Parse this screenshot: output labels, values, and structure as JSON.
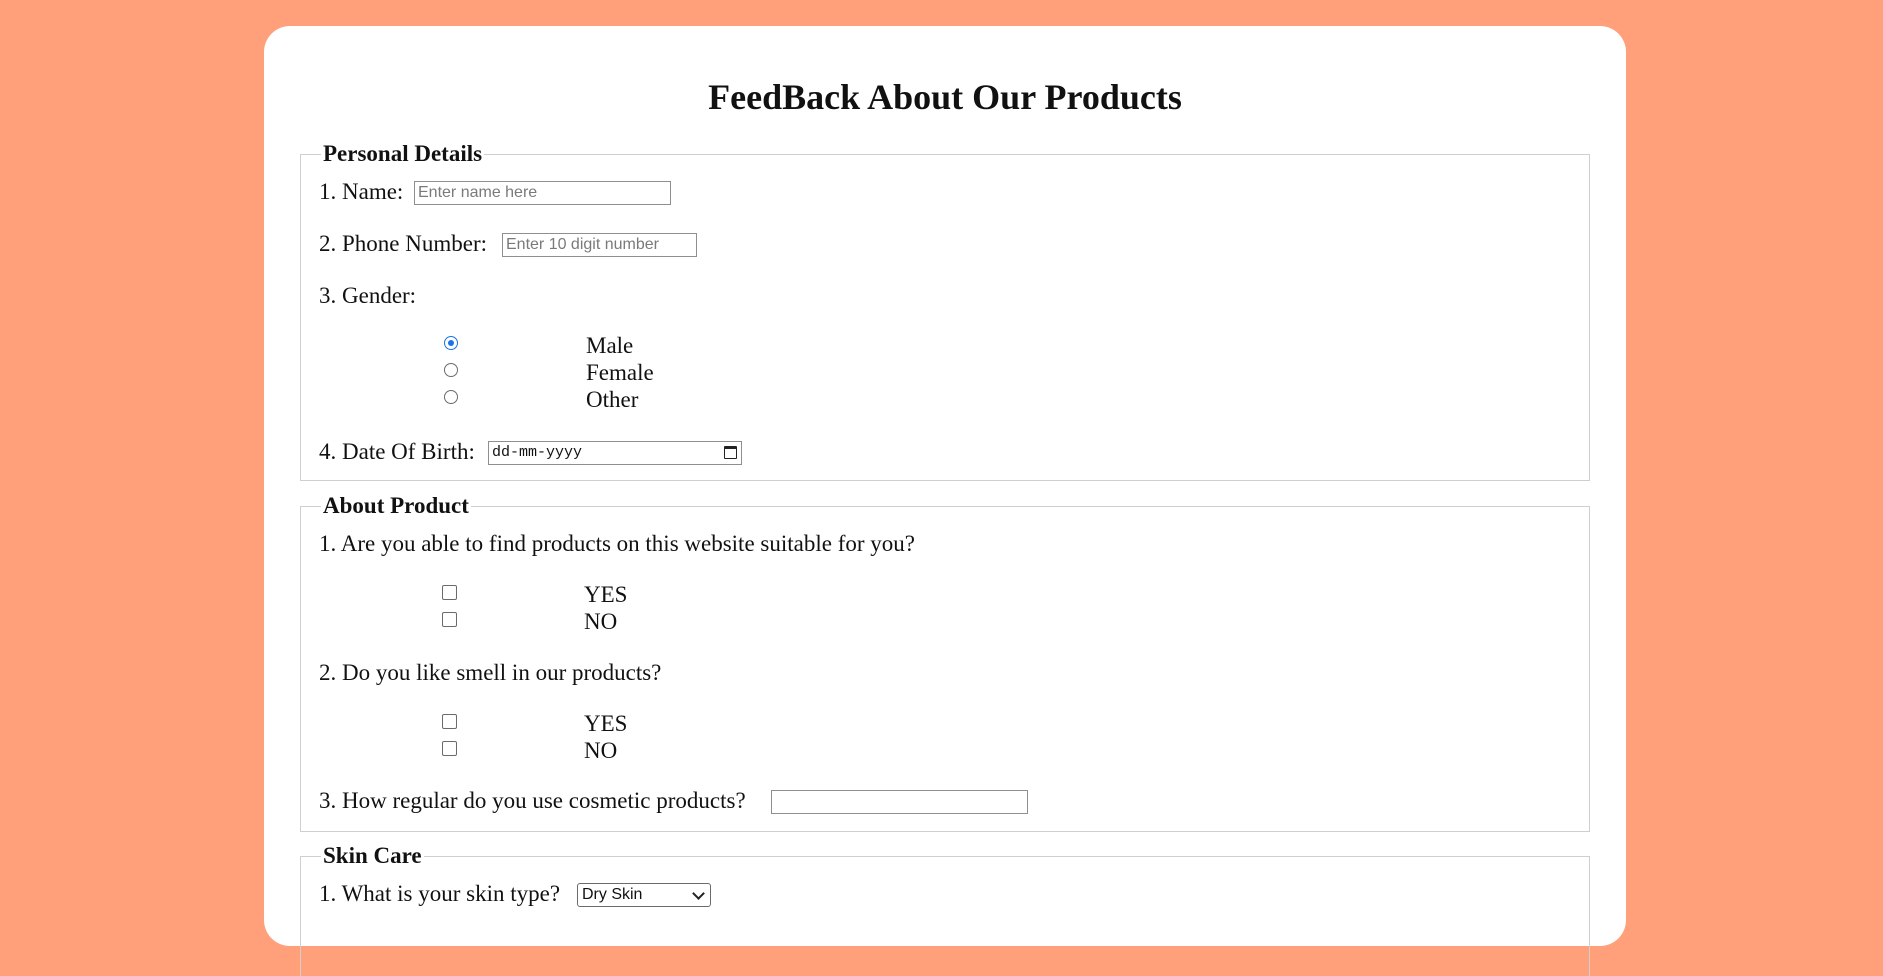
{
  "form": {
    "title": "FeedBack About Our Products",
    "personal": {
      "legend": "Personal Details",
      "name_label": "1. Name:",
      "name_placeholder": "Enter name here",
      "phone_label": "2. Phone Number:",
      "phone_placeholder": "Enter 10 digit number",
      "gender_label": "3. Gender:",
      "gender_options": [
        "Male",
        "Female",
        "Other"
      ],
      "gender_selected": "Male",
      "dob_label": "4. Date Of Birth:",
      "dob_placeholder": "dd-mm-yyyy"
    },
    "product": {
      "legend": "About Product",
      "q1": "1. Are you able to find products on this website suitable for you?",
      "q1_options": [
        "YES",
        "NO"
      ],
      "q2": "2. Do you like smell in our products?",
      "q2_options": [
        "YES",
        "NO"
      ],
      "q3": "3. How regular do you use cosmetic products?",
      "q3_value": ""
    },
    "skin": {
      "legend": "Skin Care",
      "q1": "1. What is your skin type?",
      "q1_selected": "Dry Skin"
    }
  },
  "colors": {
    "page_background": "#ffa07a",
    "card_background": "#ffffff",
    "radio_accent": "#1a73e8"
  },
  "icons": {
    "date_picker": "calendar-icon",
    "select": "chevron-down-icon"
  }
}
